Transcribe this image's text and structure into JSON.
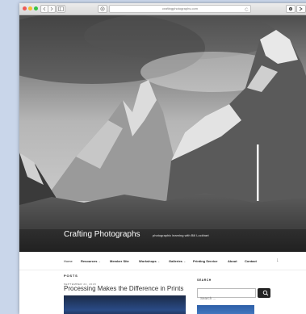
{
  "browser": {
    "address": "craftingphotographs.com",
    "back_icon": "chevron-left-icon",
    "forward_icon": "chevron-right-icon",
    "sidebar_icon": "sidebar-icon",
    "shield_icon": "shield-icon",
    "reload_icon": "reload-icon",
    "share_icon": "gear-icon",
    "more_icon": "more-icon"
  },
  "site": {
    "title": "Crafting Photographs",
    "tagline": "photographic learning with Bill Lockhart"
  },
  "nav": {
    "items": [
      {
        "label": "Home"
      },
      {
        "label": "Resources",
        "has_dropdown": true
      },
      {
        "label": "Member Site"
      },
      {
        "label": "Workshops",
        "has_dropdown": true
      },
      {
        "label": "Galleries",
        "has_dropdown": true
      },
      {
        "label": "Printing Service"
      },
      {
        "label": "About"
      },
      {
        "label": "Contact"
      }
    ],
    "scroll_icon": "arrow-down-icon"
  },
  "main": {
    "section_label": "POSTS",
    "post": {
      "date": "SEPTEMBER 24, 2018",
      "title": "Processing Makes the Difference in Prints"
    }
  },
  "sidebar": {
    "search_label": "SEARCH",
    "search_placeholder": "Search ...",
    "search_icon": "search-icon"
  },
  "colors": {
    "desktop": "#c9d6ea",
    "accent_dark": "#222222"
  }
}
